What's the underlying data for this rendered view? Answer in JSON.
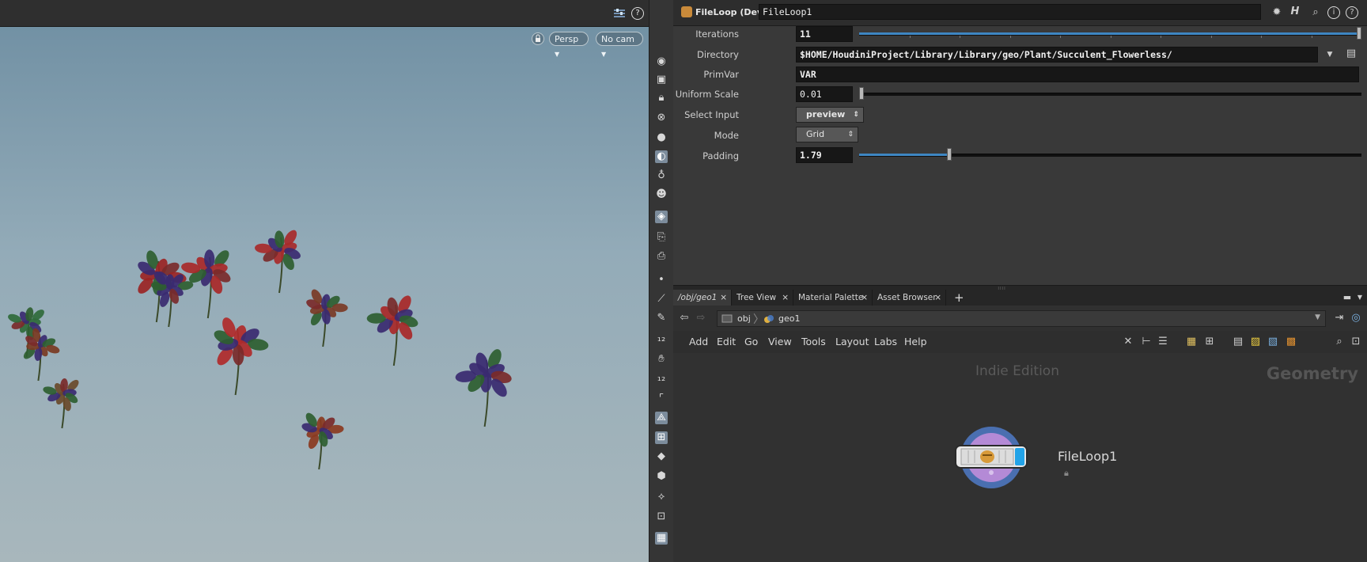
{
  "viewport": {
    "persp_label": "Persp",
    "cam_label": "No cam",
    "help_glyph": "?"
  },
  "parameters": {
    "node_type": "FileLoop (Dev)",
    "node_name": "FileLoop1",
    "rows": {
      "iterations": {
        "label": "Iterations",
        "value": "11",
        "slider_fraction": 1.0
      },
      "directory": {
        "label": "Directory",
        "value": "$HOME/HoudiniProject/Library/Library/geo/Plant/Succulent_Flowerless/"
      },
      "primvar": {
        "label": "PrimVar",
        "value": "VAR"
      },
      "uniform_scale": {
        "label": "Uniform Scale",
        "value": "0.01",
        "slider_fraction": 0.0
      },
      "select_input": {
        "label": "Select Input",
        "value": "preview"
      },
      "mode": {
        "label": "Mode",
        "value": "Grid"
      },
      "padding": {
        "label": "Padding",
        "value": "1.79",
        "slider_fraction": 0.179
      }
    },
    "header_icons": [
      "gear-icon",
      "houdini-h-icon",
      "search-icon",
      "info-icon",
      "help-icon"
    ]
  },
  "network": {
    "tabs": [
      {
        "label": "/obj/geo1",
        "close": "×"
      },
      {
        "label": "Tree View",
        "close": "×"
      },
      {
        "label": "Material Palette",
        "close": "×"
      },
      {
        "label": "Asset Browser",
        "close": "×"
      }
    ],
    "add_tab": "+",
    "path": {
      "root": "obj",
      "current": "geo1"
    },
    "menu": [
      "Add",
      "Edit",
      "Go",
      "View",
      "Tools",
      "Layout",
      "Labs",
      "Help"
    ],
    "watermark": "Indie Edition",
    "context_label": "Geometry",
    "node": {
      "name": "FileLoop1"
    }
  },
  "colors": {
    "accent_blue": "#3e86c2",
    "node_ring": "#4a6fb0",
    "node_inner": "#b48ad6",
    "sky_top": "#6e8ea2",
    "sky_bottom": "#a8b7bc"
  }
}
